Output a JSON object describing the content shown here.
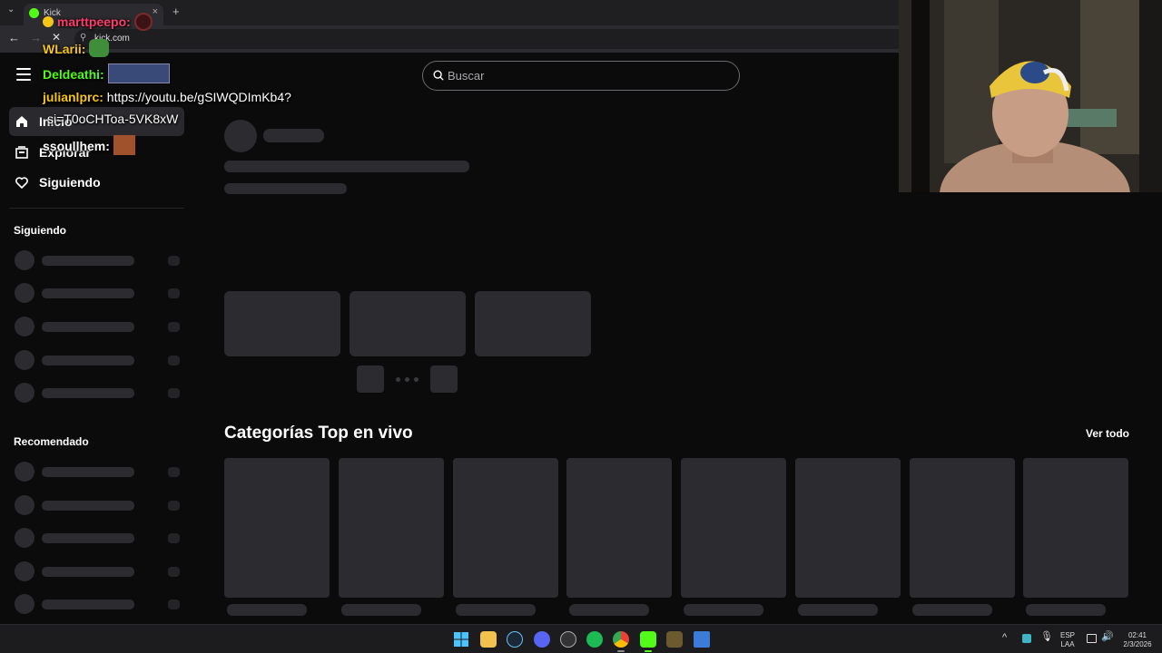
{
  "browser": {
    "tab_title": "Kick",
    "url": "kick.com",
    "new_tab": "+",
    "close": "×"
  },
  "header": {
    "search_placeholder": "Buscar"
  },
  "sidebar": {
    "nav": [
      {
        "label": "Inicio",
        "icon": "home-icon"
      },
      {
        "label": "Explorar",
        "icon": "browse-icon"
      },
      {
        "label": "Siguiendo",
        "icon": "heart-icon"
      }
    ],
    "following_heading": "Siguiendo",
    "recommended_heading": "Recomendado"
  },
  "main": {
    "categories_title": "Categorías Top en vivo",
    "see_all": "Ver todo"
  },
  "chat": [
    {
      "user": "marttpeepo:",
      "message": "",
      "color": "#ff3b6b"
    },
    {
      "user": "WLarii:",
      "message": "",
      "color": "#f5c518"
    },
    {
      "user": "Deldeathi:",
      "message": "",
      "color": "#53fc18"
    },
    {
      "user": "julianlprc:",
      "message": "https://youtu.be/gSIWQDImKb4?",
      "color": "#f5c518"
    },
    {
      "user": "",
      "message": "si=T0oCHToa-5VK8xW",
      "color": "#ffffff"
    },
    {
      "user": "ssoullhem:",
      "message": "",
      "color": "#ffffff"
    }
  ],
  "taskbar": {
    "lang_top": "ESP",
    "lang_bottom": "LAA",
    "time": "02:41",
    "date": "2/3/2026",
    "tray_chevron": "^"
  },
  "colors": {
    "kick_green": "#53fc18",
    "skeleton": "#2c2c30",
    "background": "#0b0b0c"
  }
}
